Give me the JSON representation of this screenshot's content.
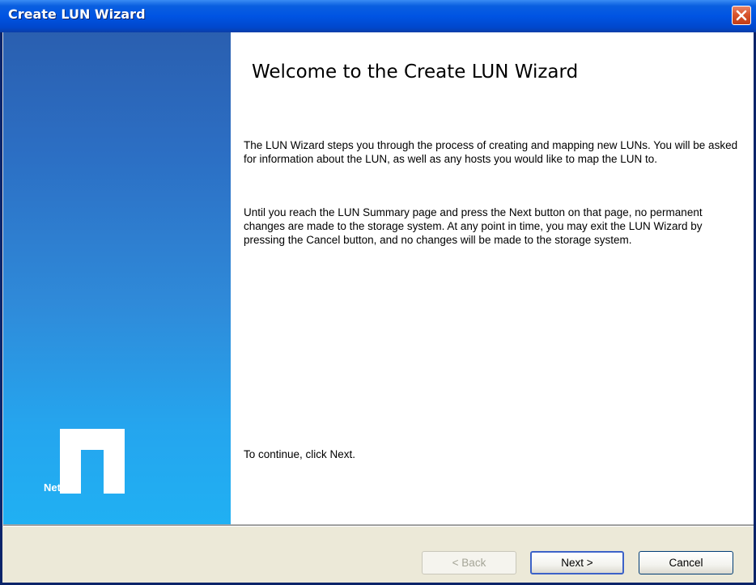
{
  "window": {
    "title": "Create LUN Wizard"
  },
  "sidebar": {
    "logo_text": "NetApp",
    "logo_icon": "netapp-logo-icon"
  },
  "main": {
    "heading": "Welcome to the Create LUN Wizard",
    "paragraph1": "The LUN Wizard steps you through the process of creating and mapping new LUNs. You will be asked for information about the LUN, as well as any hosts you would like to map the LUN to.",
    "paragraph2": "Until you reach the LUN Summary page and press the Next button on that page, no permanent changes are made to the storage system. At any point in time, you may exit the LUN Wizard by pressing the Cancel button, and no changes will be made to the storage system.",
    "continue_text": "To continue, click Next."
  },
  "footer": {
    "back_label": "< Back",
    "next_label": "Next >",
    "cancel_label": "Cancel"
  },
  "colors": {
    "titlebar": "#0054e3",
    "close_button": "#d8542c",
    "sidebar_top": "#2a5fb0",
    "sidebar_bottom": "#20b0f3",
    "footer_bg": "#ece9d8"
  }
}
